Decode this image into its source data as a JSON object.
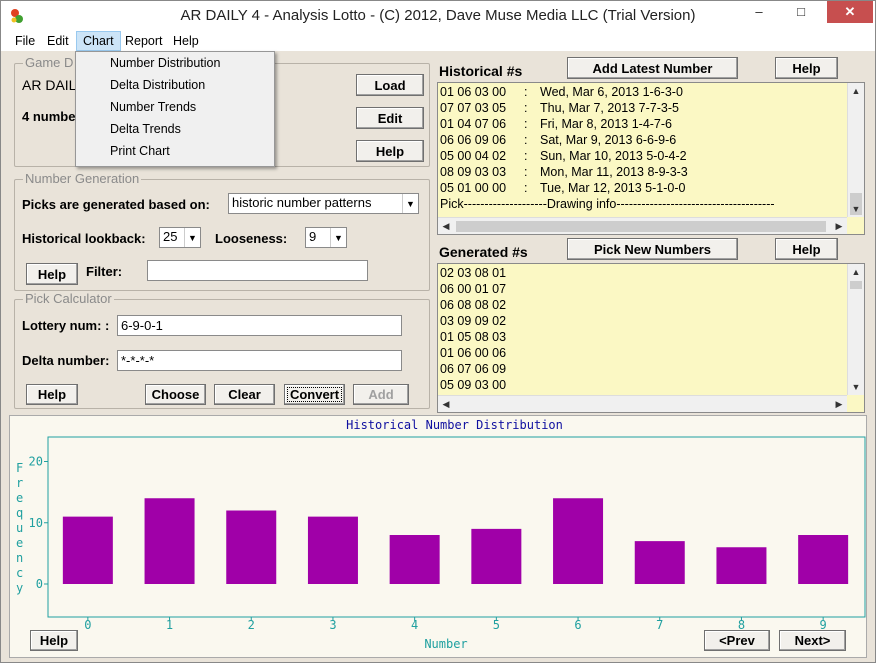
{
  "window": {
    "title": "AR DAILY 4 - Analysis Lotto - (C) 2012, Dave Muse Media LLC (Trial Version)",
    "minimize": "–",
    "maximize": "□",
    "close": "✕"
  },
  "menubar": [
    "File",
    "Edit",
    "Chart",
    "Report",
    "Help"
  ],
  "chart_menu": [
    "Number Distribution",
    "Delta Distribution",
    "Number Trends",
    "Delta Trends",
    "Print Chart"
  ],
  "game": {
    "group_title": "Game D",
    "name": "AR DAIL",
    "numbers": "4 numbe",
    "load": "Load",
    "edit": "Edit",
    "help": "Help"
  },
  "generation": {
    "group_title": "Number Generation",
    "picks_label": "Picks are generated based on:",
    "picks_value": "historic number patterns",
    "lookback_label": "Historical lookback:",
    "lookback_value": "25",
    "looseness_label": "Looseness:",
    "looseness_value": "9",
    "help": "Help",
    "filter_label": "Filter:",
    "filter_value": ""
  },
  "calculator": {
    "group_title": "Pick Calculator",
    "lottery_label": "Lottery num: :",
    "lottery_value": "6-9-0-1",
    "delta_label": "Delta number:",
    "delta_value": "*-*-*-*",
    "help": "Help",
    "choose": "Choose",
    "clear": "Clear",
    "convert": "Convert",
    "add": "Add"
  },
  "historical": {
    "label": "Historical #s",
    "add_latest": "Add Latest Number",
    "help": "Help",
    "rows": [
      {
        "nums": "01 06 03 00",
        "sep": ":",
        "info": "Wed, Mar 6, 2013 1-6-3-0"
      },
      {
        "nums": "07 07 03 05",
        "sep": ":",
        "info": "Thu, Mar 7, 2013 7-7-3-5"
      },
      {
        "nums": "01 04 07 06",
        "sep": ":",
        "info": "Fri, Mar 8, 2013 1-4-7-6"
      },
      {
        "nums": "06 06 09 06",
        "sep": ":",
        "info": "Sat, Mar 9, 2013 6-6-9-6"
      },
      {
        "nums": "05 00 04 02",
        "sep": ":",
        "info": "Sun, Mar 10, 2013 5-0-4-2"
      },
      {
        "nums": "08 09 03 03",
        "sep": ":",
        "info": "Mon, Mar 11, 2013 8-9-3-3"
      },
      {
        "nums": "05 01 00 00",
        "sep": ":",
        "info": "Tue, Mar 12, 2013 5-1-0-0"
      }
    ],
    "footer": "Pick--------------------Drawing info--------------------------------------"
  },
  "generated": {
    "label": "Generated #s",
    "pick_new": "Pick New Numbers",
    "help": "Help",
    "rows": [
      "02 03 08 01",
      "06 00 01 07",
      "06 08 08 02",
      "03 09 09 02",
      "01 05 08 03",
      "01 06 00 06",
      "06 07 06 09",
      "05 09 03 00"
    ]
  },
  "chart_buttons": {
    "help": "Help",
    "prev": "<Prev",
    "next": "Next>"
  },
  "chart_data": {
    "type": "bar",
    "title": "Historical Number Distribution",
    "xlabel": "Number",
    "ylabel": "Frequency",
    "categories": [
      "0",
      "1",
      "2",
      "3",
      "4",
      "5",
      "6",
      "7",
      "8",
      "9"
    ],
    "values": [
      11,
      14,
      12,
      11,
      8,
      9,
      14,
      7,
      6,
      8
    ],
    "ylim": [
      0,
      24
    ],
    "yticks": [
      0,
      10,
      20
    ],
    "bar_color": "#a000a8",
    "axis_color": "#20a0a0",
    "title_color": "#1010a0",
    "grid": false
  }
}
